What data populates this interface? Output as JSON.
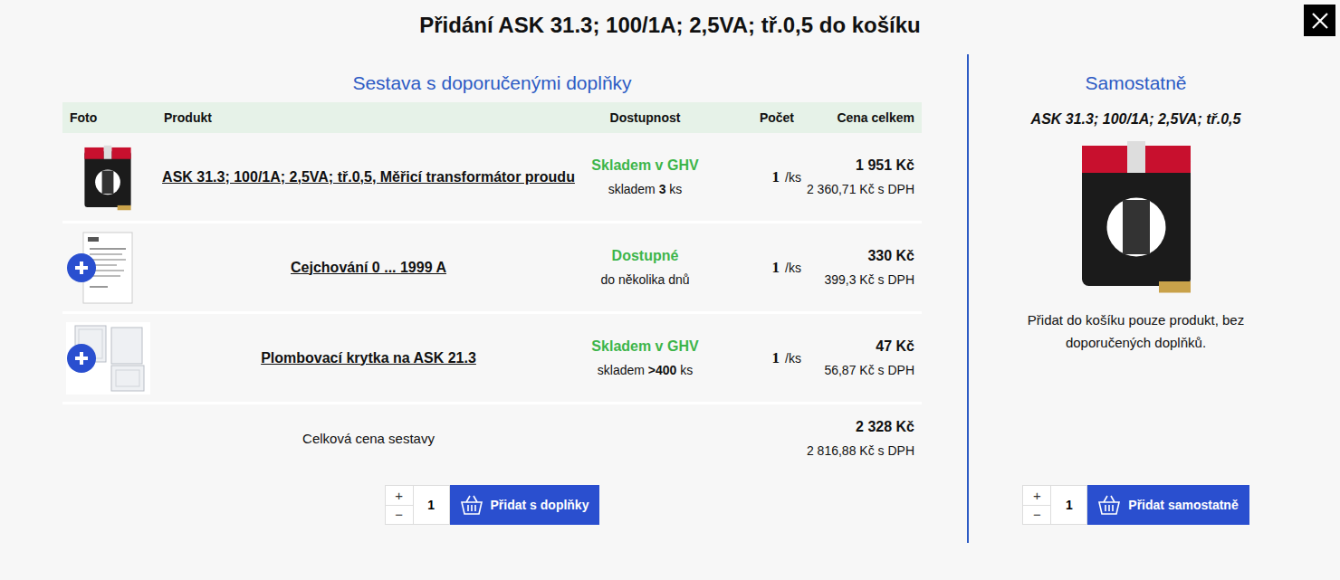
{
  "dialog": {
    "title": "Přidání ASK 31.3; 100/1A; 2,5VA; tř.0,5 do košíku"
  },
  "bundle": {
    "heading": "Sestava s doporučenými doplňky",
    "columns": [
      "Foto",
      "Produkt",
      "Dostupnost",
      "Počet",
      "Cena celkem"
    ],
    "rows": [
      {
        "kind": "transformer",
        "addon": false,
        "name": "ASK 31.3; 100/1A; 2,5VA; tř.0,5, Měřicí transformátor proudu",
        "availability": "Skladem v GHV",
        "stock": [
          {
            "text": "skladem",
            "bold": false
          },
          {
            "text": "3",
            "bold": true
          },
          {
            "text": "ks",
            "bold": false
          }
        ],
        "count": "1",
        "unit": "/ks",
        "price": "1 951 Kč",
        "price_vat": "2 360,71 Kč s DPH"
      },
      {
        "kind": "document",
        "addon": true,
        "name": "Cejchování 0 ... 1999 A",
        "availability": "Dostupné",
        "stock": [
          {
            "text": "do několika dnů",
            "bold": false
          }
        ],
        "count": "1",
        "unit": "/ks",
        "price": "330 Kč",
        "price_vat": "399,3 Kč s DPH"
      },
      {
        "kind": "cover",
        "addon": true,
        "name": "Plombovací krytka na ASK 21.3",
        "availability": "Skladem v GHV",
        "stock": [
          {
            "text": "skladem",
            "bold": false
          },
          {
            "text": ">400",
            "bold": true
          },
          {
            "text": "ks",
            "bold": false
          }
        ],
        "count": "1",
        "unit": "/ks",
        "price": "47 Kč",
        "price_vat": "56,87 Kč s DPH"
      }
    ],
    "total": {
      "label": "Celková cena sestavy",
      "price": "2 328 Kč",
      "price_vat": "2 816,88 Kč s DPH"
    },
    "add": {
      "plus": "+",
      "minus": "−",
      "qty": "1",
      "label": "Přidat s doplňky"
    }
  },
  "single": {
    "heading": "Samostatně",
    "product": "ASK 31.3; 100/1A; 2,5VA; tř.0,5",
    "note": "Přidat do košíku pouze produkt, bez doporučených doplňků.",
    "add": {
      "plus": "+",
      "minus": "−",
      "qty": "1",
      "label": "Přidat samostatně"
    }
  }
}
